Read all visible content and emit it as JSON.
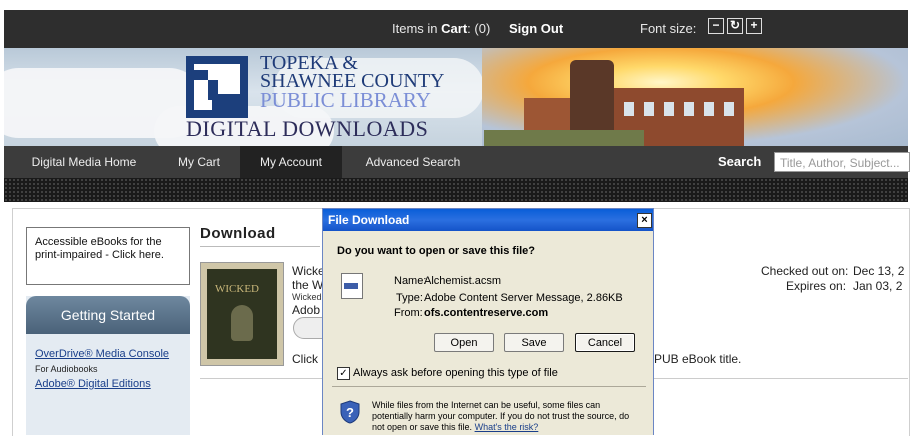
{
  "topbar": {
    "cart_label": "Items in",
    "cart_strong": "Cart",
    "cart_count": ": (0)",
    "signout": "Sign Out",
    "font_size_label": "Font size:",
    "font_decrease": "−",
    "font_reset": "↻",
    "font_increase": "+"
  },
  "banner": {
    "line1": "TOPEKA &",
    "line2": "SHAWNEE COUNTY",
    "line3": "PUBLIC LIBRARY",
    "line4": "DIGITAL DOWNLOADS"
  },
  "nav": {
    "items": [
      {
        "label": "Digital Media Home"
      },
      {
        "label": "My Cart"
      },
      {
        "label": "My Account"
      },
      {
        "label": "Advanced Search"
      }
    ],
    "search_label": "Search",
    "search_placeholder": "Title, Author, Subject..."
  },
  "sidebar": {
    "access_text": "Accessible eBooks for the print-impaired - Click here.",
    "getting_started": "Getting Started",
    "links": [
      {
        "label": "OverDrive® Media Console",
        "sub": "For Audiobooks"
      },
      {
        "label": "Adobe® Digital Editions"
      }
    ]
  },
  "main": {
    "download_title": "Download",
    "book_line1": "Wicke",
    "book_line2": "the W",
    "book_line3": "Wicked",
    "book_line4": "Adob",
    "click_text": "Click",
    "epub_text": "PUB eBook title.",
    "checked_out_label": "Checked out on:",
    "checked_out_value": "Dec 13, 2",
    "expires_label": "Expires on:",
    "expires_value": "Jan 03, 2"
  },
  "dialog": {
    "title": "File Download",
    "close": "×",
    "question": "Do you want to open or save this file?",
    "name_label": "Name:",
    "name_value": "Alchemist.acsm",
    "type_label": "Type:",
    "type_value": "Adobe Content Server Message, 2.86KB",
    "from_label": "From:",
    "from_value": "ofs.contentreserve.com",
    "open": "Open",
    "save": "Save",
    "cancel": "Cancel",
    "always_ask": "Always ask before opening this type of file",
    "warning": "While files from the Internet can be useful, some files can potentially harm your computer. If you do not trust the source, do not open or save this file.",
    "risk_link": "What's the risk?"
  },
  "colors": {
    "nav_bg": "#3c3c3c",
    "logo_blue": "#1c3f7c",
    "dialog_title": "#0a5ed8",
    "dialog_bg": "#ece9d8"
  }
}
